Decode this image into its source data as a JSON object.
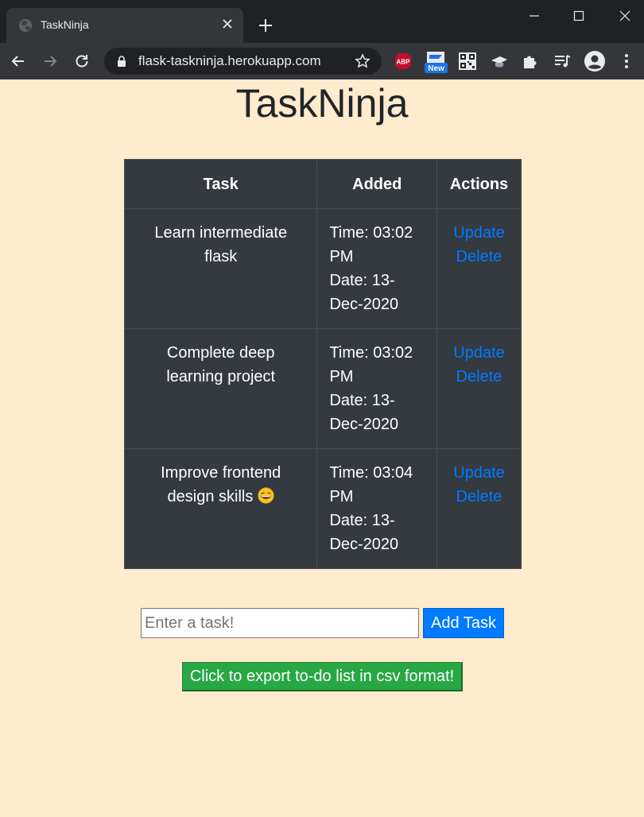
{
  "browser": {
    "tab_title": "TaskNinja",
    "url": "flask-taskninja.herokuapp.com",
    "extensions": [
      "abp-icon",
      "new-badge-icon",
      "qr-code-icon",
      "graduation-cap-icon",
      "puzzle-icon",
      "media-queue-icon",
      "profile-icon",
      "menu-icon"
    ],
    "abp_label": "ABP",
    "new_badge_label": "New"
  },
  "page": {
    "title": "TaskNinja"
  },
  "table": {
    "headers": {
      "task": "Task",
      "added": "Added",
      "actions": "Actions"
    },
    "rows": [
      {
        "task": "Learn intermediate flask",
        "time": "Time: 03:02 PM",
        "date": "Date: 13-Dec-2020",
        "update_label": "Update",
        "delete_label": "Delete"
      },
      {
        "task": "Complete deep learning project",
        "time": "Time: 03:02 PM",
        "date": "Date: 13-Dec-2020",
        "update_label": "Update",
        "delete_label": "Delete"
      },
      {
        "task": "Improve frontend design skills",
        "task_emoji": "laughing-face-icon",
        "time": "Time: 03:04 PM",
        "date": "Date: 13-Dec-2020",
        "update_label": "Update",
        "delete_label": "Delete"
      }
    ]
  },
  "form": {
    "input_placeholder": "Enter a task!",
    "input_value": "",
    "add_label": "Add Task"
  },
  "export": {
    "label": "Click to export to-do list in csv format!"
  },
  "colors": {
    "page_background": "#ffebcd",
    "table_background": "#343a40",
    "link": "#007bff",
    "primary_button": "#007bff",
    "success_button": "#28a745"
  }
}
